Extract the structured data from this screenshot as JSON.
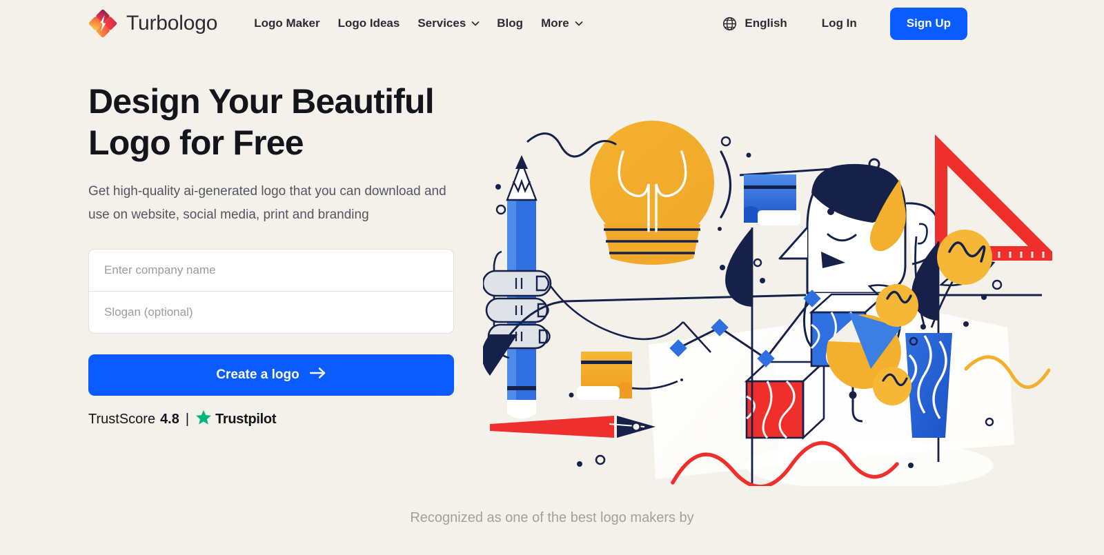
{
  "colors": {
    "background": "#F4F1EA",
    "primary_blue": "#0B5CFF",
    "text_dark": "#14141b",
    "text_muted": "#55555f",
    "placeholder": "#9b9b9f",
    "trustpilot_green": "#00B67A",
    "illustration_navy": "#16214A",
    "illustration_yellow": "#F3B02E",
    "illustration_red": "#EE2F2B",
    "illustration_blue": "#2F6FE0"
  },
  "header": {
    "brand": {
      "name": "Turbologo",
      "logo_icon": "turbologo-diamond-spark-icon"
    },
    "nav": [
      {
        "label": "Logo Maker",
        "has_dropdown": false
      },
      {
        "label": "Logo Ideas",
        "has_dropdown": false
      },
      {
        "label": "Services",
        "has_dropdown": true
      },
      {
        "label": "Blog",
        "has_dropdown": false
      },
      {
        "label": "More",
        "has_dropdown": true
      }
    ],
    "language": {
      "icon": "globe-icon",
      "label": "English"
    },
    "login_label": "Log In",
    "signup_label": "Sign Up"
  },
  "hero": {
    "headline_line1": "Design Your Beautiful",
    "headline_line2": "Logo for Free",
    "subheadline_line1": "Get high-quality ai-generated logo that you can download and",
    "subheadline_line2": "use on website, social media, print and branding",
    "company_input": {
      "placeholder": "Enter company name",
      "value": ""
    },
    "slogan_input": {
      "placeholder": "Slogan (optional)",
      "value": ""
    },
    "cta_label": "Create a logo",
    "cta_icon": "arrow-right-icon",
    "trustpilot": {
      "label": "TrustScore",
      "score": "4.8",
      "separator": "|",
      "star_icon": "trustpilot-star-icon",
      "brand": "Trustpilot"
    },
    "illustration_alt": "designer-workspace-illustration"
  },
  "footer_note": {
    "text": "Recognized as one of the best logo makers by"
  }
}
